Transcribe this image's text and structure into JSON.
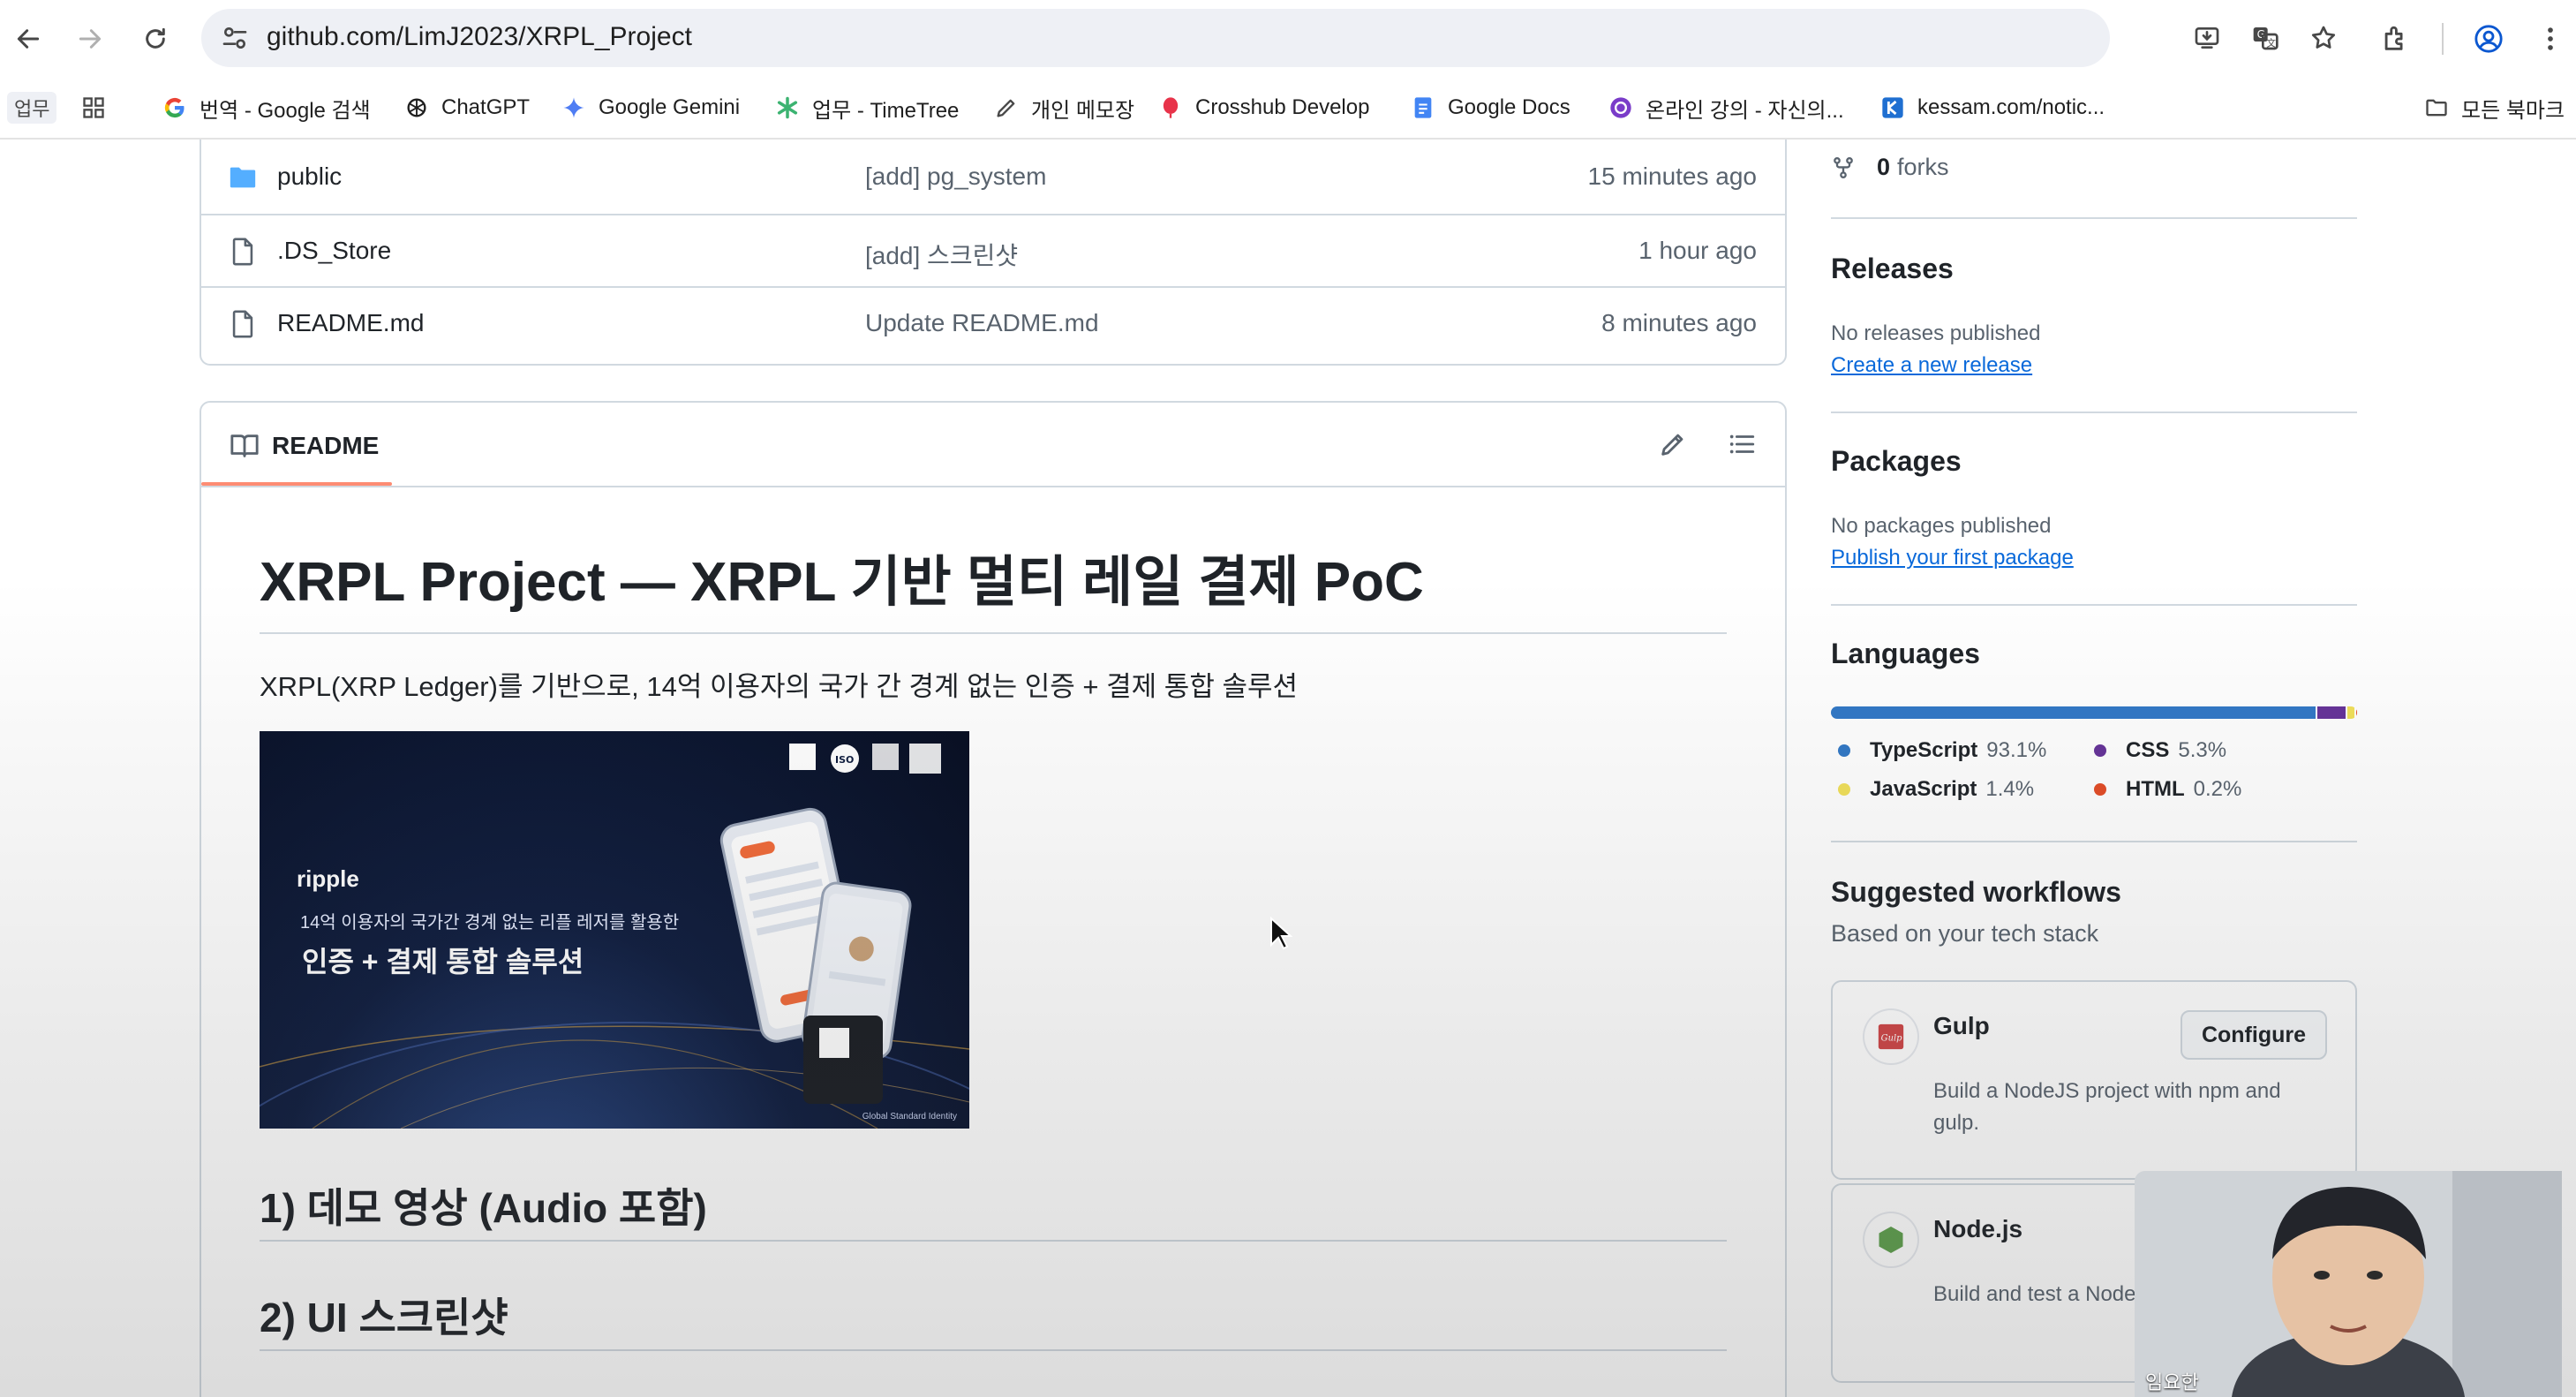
{
  "browser": {
    "url": "github.com/LimJ2023/XRPL_Project",
    "bookmarks": [
      {
        "label": "업무",
        "icon": "folder-tag-icon"
      },
      {
        "label": "",
        "icon": "apps-grid-icon"
      },
      {
        "label": "번역 - Google 검색",
        "icon": "google-icon"
      },
      {
        "label": "ChatGPT",
        "icon": "chatgpt-icon"
      },
      {
        "label": "Google Gemini",
        "icon": "gemini-icon"
      },
      {
        "label": "업무 - TimeTree",
        "icon": "timetree-icon"
      },
      {
        "label": "개인 메모장",
        "icon": "pencil-icon"
      },
      {
        "label": "Crosshub Develop",
        "icon": "balloon-icon"
      },
      {
        "label": "Google Docs",
        "icon": "docs-icon"
      },
      {
        "label": "온라인 강의 - 자신의...",
        "icon": "lecture-icon"
      },
      {
        "label": "kessam.com/notic...",
        "icon": "kessam-icon"
      }
    ],
    "all_bookmarks": "모든 북마크"
  },
  "files": [
    {
      "name": "public",
      "type": "folder",
      "message": "[add] pg_system",
      "time": "15 minutes ago"
    },
    {
      "name": ".DS_Store",
      "type": "file",
      "message": "[add] 스크린샷",
      "time": "1 hour ago"
    },
    {
      "name": "README.md",
      "type": "file",
      "message": "Update README.md",
      "time": "8 minutes ago"
    }
  ],
  "readme": {
    "tab_label": "README",
    "title": "XRPL Project — XRPL 기반 멀티 레일 결제 PoC",
    "description": "XRPL(XRP Ledger)를 기반으로, 14억 이용자의 국가 간 경계 없는 인증 + 결제 통합 솔루션",
    "banner": {
      "brand": "ripple",
      "subtitle": "14억 이용자의 국가간 경계 없는 리플 레저를 활용한",
      "headline": "인증 + 결제 통합 솔루션",
      "footer": "Global Standard Identity"
    },
    "section1": "1) 데모 영상 (Audio 포함)",
    "section2": "2) UI 스크린샷"
  },
  "sidebar": {
    "forks_count": "0",
    "forks_label": "forks",
    "releases": {
      "heading": "Releases",
      "text": "No releases published",
      "link": "Create a new release"
    },
    "packages": {
      "heading": "Packages",
      "text": "No packages published",
      "link": "Publish your first package"
    },
    "languages": {
      "heading": "Languages",
      "items": [
        {
          "name": "TypeScript",
          "percent": "93.1%",
          "value": 93.1,
          "color": "#3178c6"
        },
        {
          "name": "CSS",
          "percent": "5.3%",
          "value": 5.3,
          "color": "#663399"
        },
        {
          "name": "JavaScript",
          "percent": "1.4%",
          "value": 1.4,
          "color": "#f1e05a"
        },
        {
          "name": "HTML",
          "percent": "0.2%",
          "value": 0.2,
          "color": "#e34c26"
        }
      ]
    },
    "workflows": {
      "heading": "Suggested workflows",
      "subheading": "Based on your tech stack",
      "items": [
        {
          "name": "Gulp",
          "description": "Build a NodeJS project with npm and gulp.",
          "button": "Configure"
        },
        {
          "name": "Node.js",
          "description": "Build and test a Node.js project with npm."
        }
      ]
    }
  },
  "webcam": {
    "name": "임요한"
  }
}
